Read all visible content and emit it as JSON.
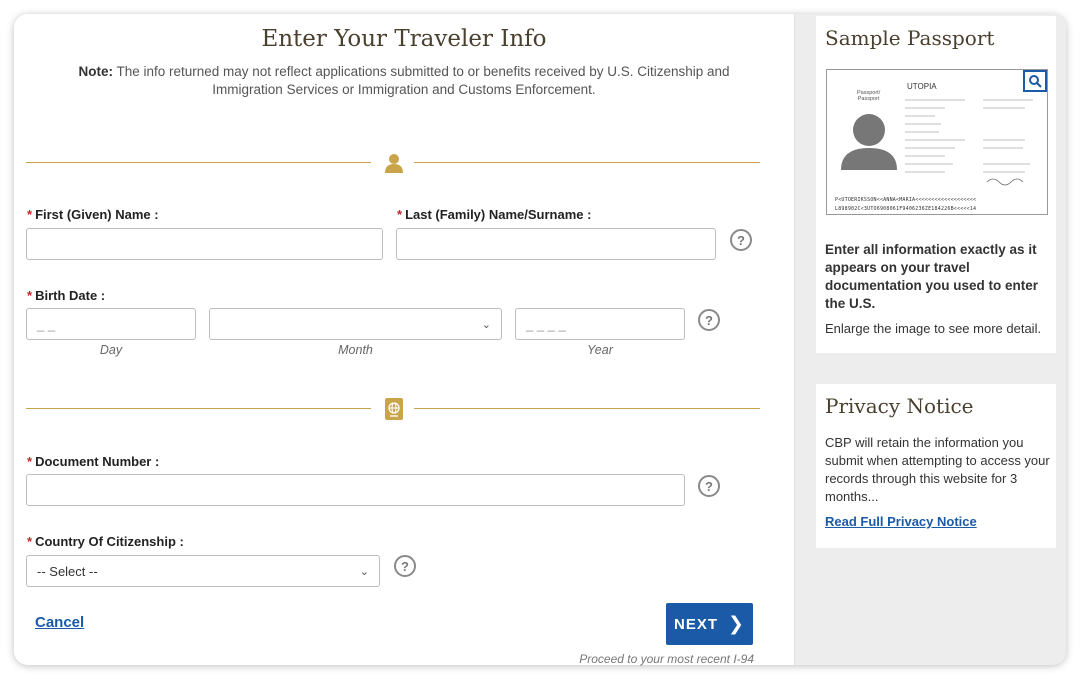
{
  "form": {
    "title": "Enter Your Traveler Info",
    "note_label": "Note:",
    "note_text": "The info returned may not reflect applications submitted to or benefits received by U.S. Citizenship and Immigration Services or Immigration and Customs Enforcement.",
    "required_mark": "*",
    "first_name": {
      "label": "First (Given) Name :",
      "value": ""
    },
    "last_name": {
      "label": "Last (Family) Name/Surname :",
      "value": ""
    },
    "birth_date": {
      "label": "Birth Date :",
      "day_placeholder": "_ _",
      "day_caption": "Day",
      "month_value": "",
      "month_caption": "Month",
      "year_placeholder": "_ _ _ _",
      "year_caption": "Year"
    },
    "document_number": {
      "label": "Document Number :",
      "value": ""
    },
    "country": {
      "label": "Country Of Citizenship :",
      "selected": "-- Select --"
    },
    "help_glyph": "?",
    "cancel_label": "Cancel",
    "next_label": "NEXT",
    "next_arrow": "❯",
    "proceed_text": "Proceed to your most recent I-94"
  },
  "sidebar": {
    "sample": {
      "heading": "Sample Passport",
      "instruction": "Enter all information exactly as it appears on your travel documentation you used to enter the U.S.",
      "enlarge_text": "Enlarge the image to see more detail."
    },
    "privacy": {
      "heading": "Privacy Notice",
      "body": "CBP will retain the information you submit when attempting to access your records through this website for 3 months...",
      "link_label": "Read Full Privacy Notice"
    }
  },
  "passport_sample": {
    "doc_type": "Passport/\nPassport",
    "country": "UTOPIA",
    "mrz_line1": "P<UTOERIKSSON<<ANNA<MARIA<<<<<<<<<<<<<<<<<<<",
    "mrz_line2": "L898902C<3UTO6908061F9406236ZE184226B<<<<<14"
  },
  "colors": {
    "accent_gold": "#c9a44b",
    "primary_blue": "#1a5aa6",
    "required_red": "#c0282d",
    "heading_brown": "#4a4030"
  }
}
